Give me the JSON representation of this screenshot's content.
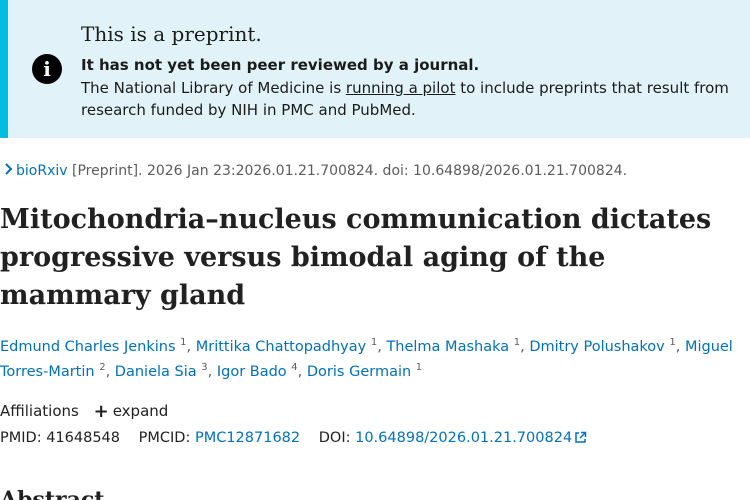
{
  "banner": {
    "icon": "info-icon",
    "icon_glyph": "i",
    "title": "This is a preprint.",
    "subtitle": "It has not yet been peer reviewed by a journal.",
    "text_before": "The National Library of Medicine is ",
    "link": "running a pilot",
    "text_after": " to include preprints that result from research funded by NIH in PMC and PubMed."
  },
  "citation": {
    "source": "bioRxiv",
    "rest": " [Preprint]. 2026 Jan 23:2026.01.21.700824. doi: 10.64898/2026.01.21.700824."
  },
  "article": {
    "title": "Mitochondria–nucleus communication dictates progressive versus bimodal aging of the mammary gland"
  },
  "authors": [
    {
      "name": "Edmund Charles Jenkins",
      "aff": "1"
    },
    {
      "name": "Mrittika Chattopadhyay",
      "aff": "1"
    },
    {
      "name": "Thelma Mashaka",
      "aff": "1"
    },
    {
      "name": "Dmitry Polushakov",
      "aff": "1"
    },
    {
      "name": "Miguel Torres-Martin",
      "aff": "2"
    },
    {
      "name": "Daniela Sia",
      "aff": "3"
    },
    {
      "name": "Igor Bado",
      "aff": "4"
    },
    {
      "name": "Doris Germain",
      "aff": "1"
    }
  ],
  "separator": ",",
  "affiliations": {
    "label": "Affiliations",
    "expand_label": "expand"
  },
  "ids": {
    "pmid_label": "PMID:",
    "pmid": "41648548",
    "pmcid_label": "PMCID:",
    "pmcid": "PMC12871682",
    "doi_label": "DOI:",
    "doi": "10.64898/2026.01.21.700824"
  },
  "abstract": {
    "heading": "Abstract"
  },
  "colors": {
    "link": "#0071bc",
    "banner_bg": "#e1f3f8",
    "banner_accent": "#00bde3"
  }
}
